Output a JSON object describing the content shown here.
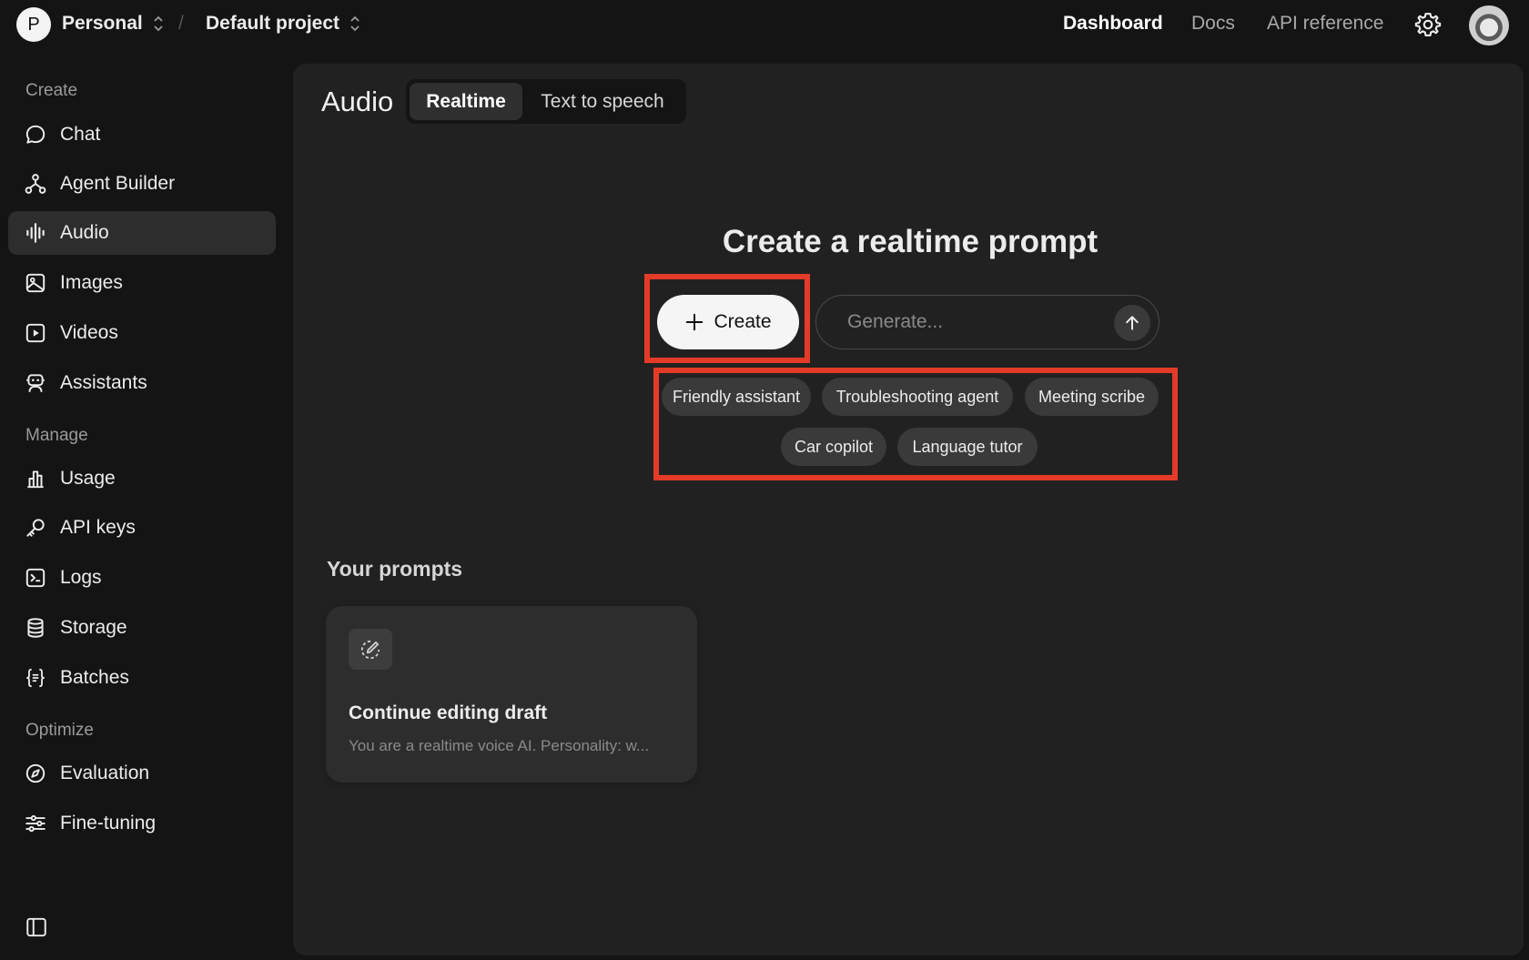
{
  "topbar": {
    "org_initial": "P",
    "org_name": "Personal",
    "separator": "/",
    "project_name": "Default project",
    "nav": [
      "Dashboard",
      "Docs",
      "API reference"
    ],
    "active_nav": "Dashboard"
  },
  "sidebar": {
    "sections": [
      {
        "label": "Create",
        "items": [
          {
            "label": "Chat",
            "icon": "chat-bubble-icon"
          },
          {
            "label": "Agent Builder",
            "icon": "agent-builder-icon"
          },
          {
            "label": "Audio",
            "icon": "audio-wave-icon",
            "active": true
          },
          {
            "label": "Images",
            "icon": "image-icon"
          },
          {
            "label": "Videos",
            "icon": "video-play-icon"
          },
          {
            "label": "Assistants",
            "icon": "robot-icon"
          }
        ]
      },
      {
        "label": "Manage",
        "items": [
          {
            "label": "Usage",
            "icon": "bar-chart-icon"
          },
          {
            "label": "API keys",
            "icon": "key-icon"
          },
          {
            "label": "Logs",
            "icon": "terminal-icon"
          },
          {
            "label": "Storage",
            "icon": "database-icon"
          },
          {
            "label": "Batches",
            "icon": "braces-icon"
          }
        ]
      },
      {
        "label": "Optimize",
        "items": [
          {
            "label": "Evaluation",
            "icon": "compass-icon"
          },
          {
            "label": "Fine-tuning",
            "icon": "sliders-icon"
          }
        ]
      }
    ]
  },
  "main": {
    "title": "Audio",
    "tabs": [
      "Realtime",
      "Text to speech"
    ],
    "active_tab": "Realtime",
    "hero_title": "Create a realtime prompt",
    "create_label": "Create",
    "generate_placeholder": "Generate...",
    "suggestions": [
      "Friendly assistant",
      "Troubleshooting agent",
      "Meeting scribe",
      "Car copilot",
      "Language tutor"
    ],
    "prompts_title": "Your prompts",
    "draft_card": {
      "title": "Continue editing draft",
      "subtitle": "You are a realtime voice AI. Personality: w..."
    }
  },
  "colors": {
    "highlight": "#e43b28",
    "background": "#141414",
    "panel": "#212121",
    "active_item": "#2d2d2d"
  }
}
